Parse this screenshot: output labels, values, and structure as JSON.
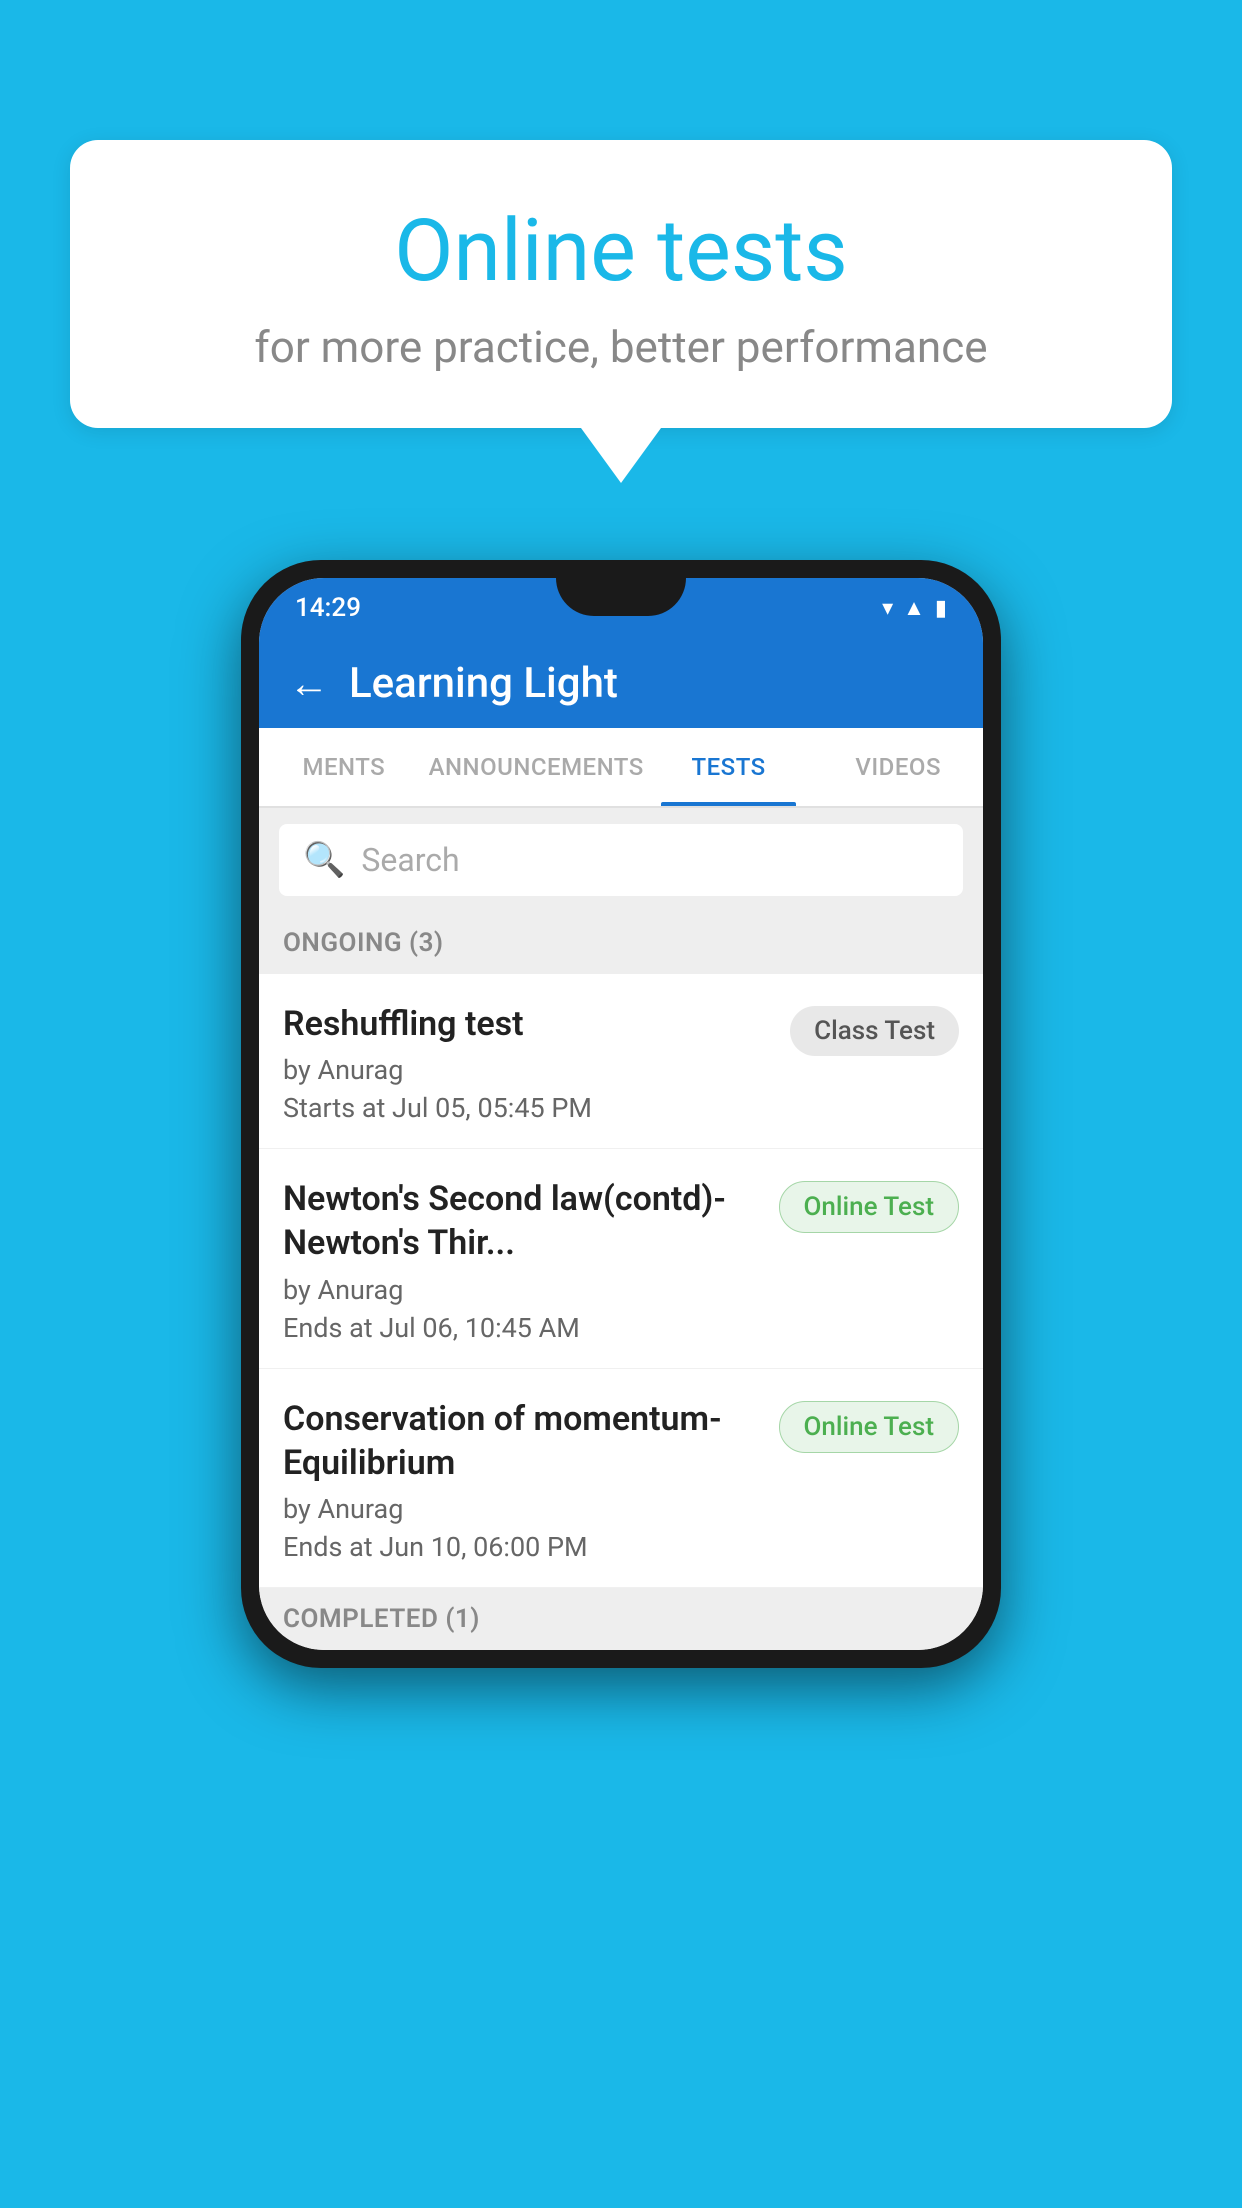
{
  "background": {
    "color": "#1ab8e8"
  },
  "speech_bubble": {
    "title": "Online tests",
    "subtitle": "for more practice, better performance"
  },
  "phone": {
    "status_bar": {
      "time": "14:29",
      "icons": [
        "wifi",
        "signal",
        "battery"
      ]
    },
    "app_bar": {
      "title": "Learning Light",
      "back_label": "←"
    },
    "tabs": [
      {
        "label": "MENTS",
        "active": false
      },
      {
        "label": "ANNOUNCEMENTS",
        "active": false
      },
      {
        "label": "TESTS",
        "active": true
      },
      {
        "label": "VIDEOS",
        "active": false
      }
    ],
    "search": {
      "placeholder": "Search"
    },
    "ongoing_section": {
      "label": "ONGOING (3)",
      "tests": [
        {
          "title": "Reshuffling test",
          "author": "by Anurag",
          "date": "Starts at  Jul 05, 05:45 PM",
          "badge": "Class Test",
          "badge_type": "class"
        },
        {
          "title": "Newton's Second law(contd)-Newton's Thir...",
          "author": "by Anurag",
          "date": "Ends at  Jul 06, 10:45 AM",
          "badge": "Online Test",
          "badge_type": "online"
        },
        {
          "title": "Conservation of momentum-Equilibrium",
          "author": "by Anurag",
          "date": "Ends at  Jun 10, 06:00 PM",
          "badge": "Online Test",
          "badge_type": "online"
        }
      ]
    },
    "completed_section": {
      "label": "COMPLETED (1)"
    }
  }
}
